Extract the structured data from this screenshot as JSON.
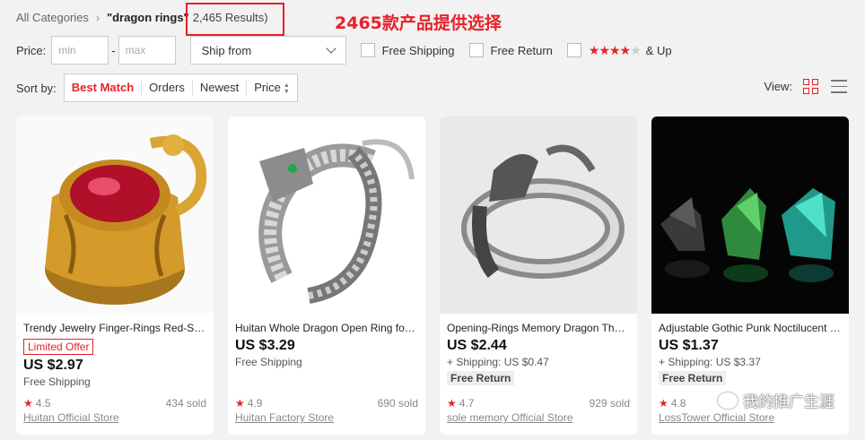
{
  "breadcrumb": {
    "root": "All Categories",
    "query": "\"dragon rings\"",
    "count": "2,465 Results)"
  },
  "annotation": "2465款产品提供选择",
  "filters": {
    "price_label": "Price:",
    "min_placeholder": "min",
    "max_placeholder": "max",
    "ship_from": "Ship from",
    "free_shipping": "Free Shipping",
    "free_return": "Free Return",
    "and_up": "& Up"
  },
  "sort": {
    "label": "Sort by:",
    "options": [
      "Best Match",
      "Orders",
      "Newest",
      "Price"
    ]
  },
  "view_label": "View:",
  "products": [
    {
      "title": "Trendy Jewelry Finger-Rings Red-Stone",
      "badge": "Limited Offer",
      "price": "US $2.97",
      "shipping": "Free Shipping",
      "rating": "4.5",
      "sold": "434 sold",
      "store": "Huitan Official Store"
    },
    {
      "title": "Huitan Whole Dragon Open Ring for Men",
      "price": "US $3.29",
      "shipping": "Free Shipping",
      "rating": "4.9",
      "sold": "690 sold",
      "store": "Huitan Factory Store"
    },
    {
      "title": "Opening-Rings Memory Dragon Thumb Ring",
      "price": "US $2.44",
      "shipping": "+ Shipping: US $0.47",
      "chip": "Free Return",
      "rating": "4.7",
      "sold": "929 sold",
      "store": "sole memory Official Store"
    },
    {
      "title": "Adjustable Gothic Punk Noctilucent Dragon Ring",
      "price": "US $1.37",
      "shipping": "+ Shipping: US $3.37",
      "chip": "Free Return",
      "rating": "4.8",
      "sold": "",
      "store": "LossTower Official Store"
    }
  ],
  "watermark": "我的推广生涯",
  "colors": {
    "accent": "#e62129",
    "background": "#f2f2f2"
  }
}
